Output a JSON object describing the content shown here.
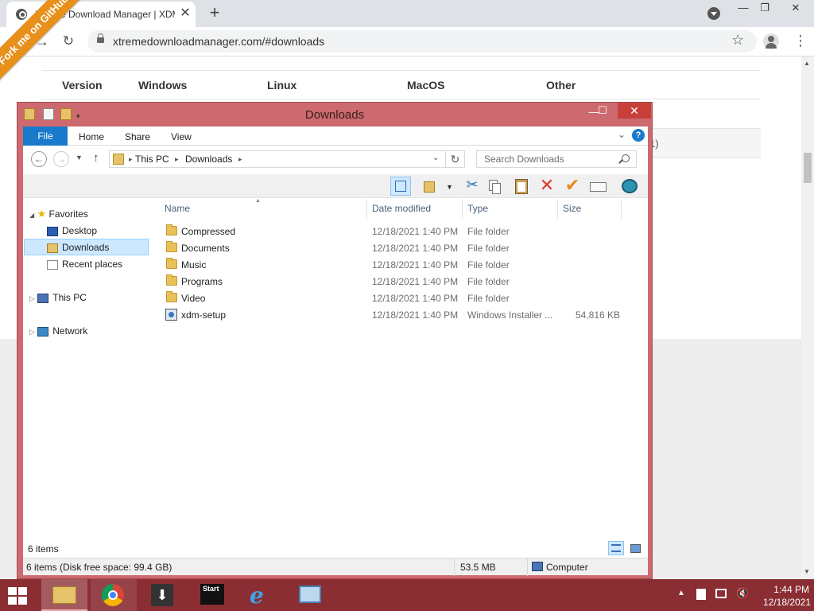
{
  "browser": {
    "tab_title": "Xtreme Download Manager | XDM",
    "tab_close": "✕",
    "new_tab": "+",
    "url": "xtremedownloadmanager.com/#downloads",
    "min": "—",
    "max": "❐",
    "close": "✕"
  },
  "webpage": {
    "ribbon": "Fork me on GitHub",
    "headers": [
      "Version",
      "Windows",
      "Linux",
      "MacOS",
      "Other"
    ],
    "row2_tail": "1)"
  },
  "explorer": {
    "title": "Downloads",
    "tabs": {
      "file": "File",
      "home": "Home",
      "share": "Share",
      "view": "View"
    },
    "help": "?",
    "address": {
      "root": "This PC",
      "current": "Downloads"
    },
    "search_placeholder": "Search Downloads",
    "nav": {
      "favorites": "Favorites",
      "desktop": "Desktop",
      "downloads": "Downloads",
      "recent": "Recent places",
      "thispc": "This PC",
      "network": "Network"
    },
    "columns": {
      "name": "Name",
      "date": "Date modified",
      "type": "Type",
      "size": "Size"
    },
    "files": [
      {
        "name": "Compressed",
        "date": "12/18/2021 1:40 PM",
        "type": "File folder",
        "size": "",
        "icon": "folder-icon"
      },
      {
        "name": "Documents",
        "date": "12/18/2021 1:40 PM",
        "type": "File folder",
        "size": "",
        "icon": "folder-icon"
      },
      {
        "name": "Music",
        "date": "12/18/2021 1:40 PM",
        "type": "File folder",
        "size": "",
        "icon": "folder-icon"
      },
      {
        "name": "Programs",
        "date": "12/18/2021 1:40 PM",
        "type": "File folder",
        "size": "",
        "icon": "folder-icon"
      },
      {
        "name": "Video",
        "date": "12/18/2021 1:40 PM",
        "type": "File folder",
        "size": "",
        "icon": "folder-icon"
      },
      {
        "name": "xdm-setup",
        "date": "12/18/2021 1:40 PM",
        "type": "Windows Installer ...",
        "size": "54,816 KB",
        "icon": "installer-icon"
      }
    ],
    "items_count": "6 items",
    "status": {
      "left": "6 items (Disk free space: 99.4 GB)",
      "size": "53.5 MB",
      "location": "Computer"
    }
  },
  "taskbar": {
    "start_label": "Start",
    "time": "1:44 PM",
    "date": "12/18/2021",
    "colors": {
      "taskbar": "#8a2e34",
      "window_frame": "#cd6a6f",
      "accent": "#1979ca"
    }
  }
}
